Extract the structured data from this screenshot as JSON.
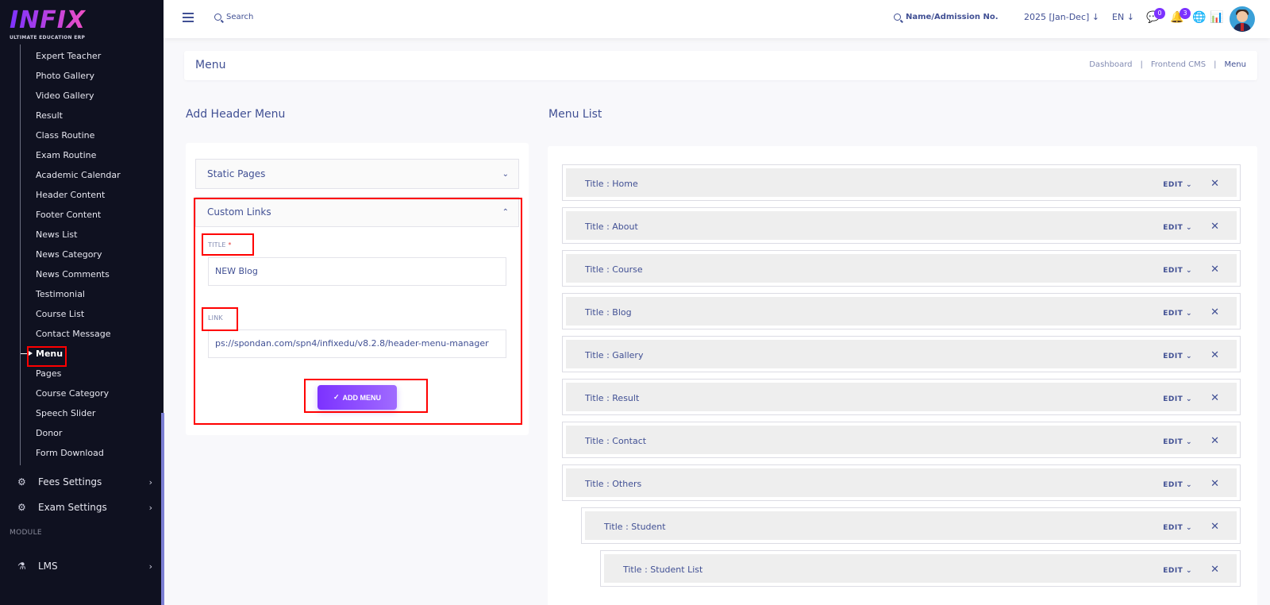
{
  "app": {
    "logo_text": "INFIX",
    "logo_subtitle": "ULTIMATE EDUCATION ERP"
  },
  "sidebar": {
    "items": [
      {
        "label": "Expert Teacher"
      },
      {
        "label": "Photo Gallery"
      },
      {
        "label": "Video Gallery"
      },
      {
        "label": "Result"
      },
      {
        "label": "Class Routine"
      },
      {
        "label": "Exam Routine"
      },
      {
        "label": "Academic Calendar"
      },
      {
        "label": "Header Content"
      },
      {
        "label": "Footer Content"
      },
      {
        "label": "News List"
      },
      {
        "label": "News Category"
      },
      {
        "label": "News Comments"
      },
      {
        "label": "Testimonial"
      },
      {
        "label": "Course List"
      },
      {
        "label": "Contact Message"
      },
      {
        "label": "Menu"
      },
      {
        "label": "Pages"
      },
      {
        "label": "Course Category"
      },
      {
        "label": "Speech Slider"
      },
      {
        "label": "Donor"
      },
      {
        "label": "Form Download"
      }
    ],
    "groups": [
      {
        "label": "Fees Settings",
        "icon": "gears-icon"
      },
      {
        "label": "Exam Settings",
        "icon": "gears-icon"
      }
    ],
    "module_heading": "MODULE",
    "lms": {
      "label": "LMS",
      "icon": "flask-icon"
    }
  },
  "topbar": {
    "search_label": "Search",
    "admission_search_label": "Name/Admission No.",
    "year": "2025 [Jan-Dec]",
    "language": "EN",
    "messages_count": "0",
    "notifications_count": "3"
  },
  "header": {
    "title": "Menu",
    "breadcrumb": [
      "Dashboard",
      "Frontend CMS",
      "Menu"
    ]
  },
  "left_panel": {
    "title": "Add Header Menu",
    "static_pages_label": "Static Pages",
    "custom_links_label": "Custom Links",
    "title_field": {
      "label": "TITLE",
      "required_mark": "*",
      "value": "NEW Blog"
    },
    "link_field": {
      "label": "LINK",
      "value": "ps://spondan.com/spn4/infixedu/v8.2.8/header-menu-manager"
    },
    "add_button_label": "ADD MENU"
  },
  "menu_list": {
    "title": "Menu List",
    "edit_label": "EDIT",
    "items": [
      {
        "title": "Title : Home",
        "level": 0
      },
      {
        "title": "Title : About",
        "level": 0
      },
      {
        "title": "Title : Course",
        "level": 0
      },
      {
        "title": "Title : Blog",
        "level": 0
      },
      {
        "title": "Title : Gallery",
        "level": 0
      },
      {
        "title": "Title : Result",
        "level": 0
      },
      {
        "title": "Title : Contact",
        "level": 0
      },
      {
        "title": "Title : Others",
        "level": 0
      },
      {
        "title": "Title : Student",
        "level": 1
      },
      {
        "title": "Title : Student List",
        "level": 2
      }
    ]
  },
  "colors": {
    "accent": "#7c32ff",
    "text": "#415094",
    "highlight": "#ff0000",
    "sidebar_bg": "#0f1120"
  }
}
